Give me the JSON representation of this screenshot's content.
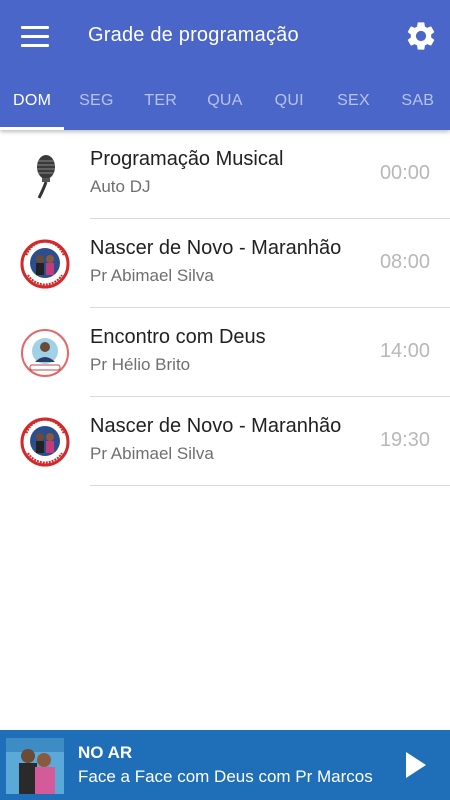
{
  "header": {
    "title": "Grade de programação",
    "menu_icon": "hamburger-menu-icon",
    "settings_icon": "gear-icon",
    "background_color": "#4a66c9"
  },
  "tabs": [
    {
      "label": "DOM",
      "active": true
    },
    {
      "label": "SEG",
      "active": false
    },
    {
      "label": "TER",
      "active": false
    },
    {
      "label": "QUA",
      "active": false
    },
    {
      "label": "QUI",
      "active": false
    },
    {
      "label": "SEX",
      "active": false
    },
    {
      "label": "SAB",
      "active": false
    }
  ],
  "schedule": [
    {
      "name": "Programação Musical",
      "host": "Auto DJ",
      "time": "00:00",
      "icon": "microphone-icon"
    },
    {
      "name": "Nascer de Novo - Maranhão",
      "host": "Pr Abimael Silva",
      "time": "08:00",
      "icon": "program-logo-nascer-de-novo"
    },
    {
      "name": "Encontro com Deus",
      "host": "Pr Hélio Brito",
      "time": "14:00",
      "icon": "program-logo-encontro-com-deus"
    },
    {
      "name": "Nascer de Novo - Maranhão",
      "host": "Pr Abimael Silva",
      "time": "19:30",
      "icon": "program-logo-nascer-de-novo"
    }
  ],
  "player": {
    "label": "NO AR",
    "now_playing": "Face a Face com Deus com Pr Marcos",
    "play_icon": "play-icon",
    "background_color": "#1e6fb8"
  }
}
